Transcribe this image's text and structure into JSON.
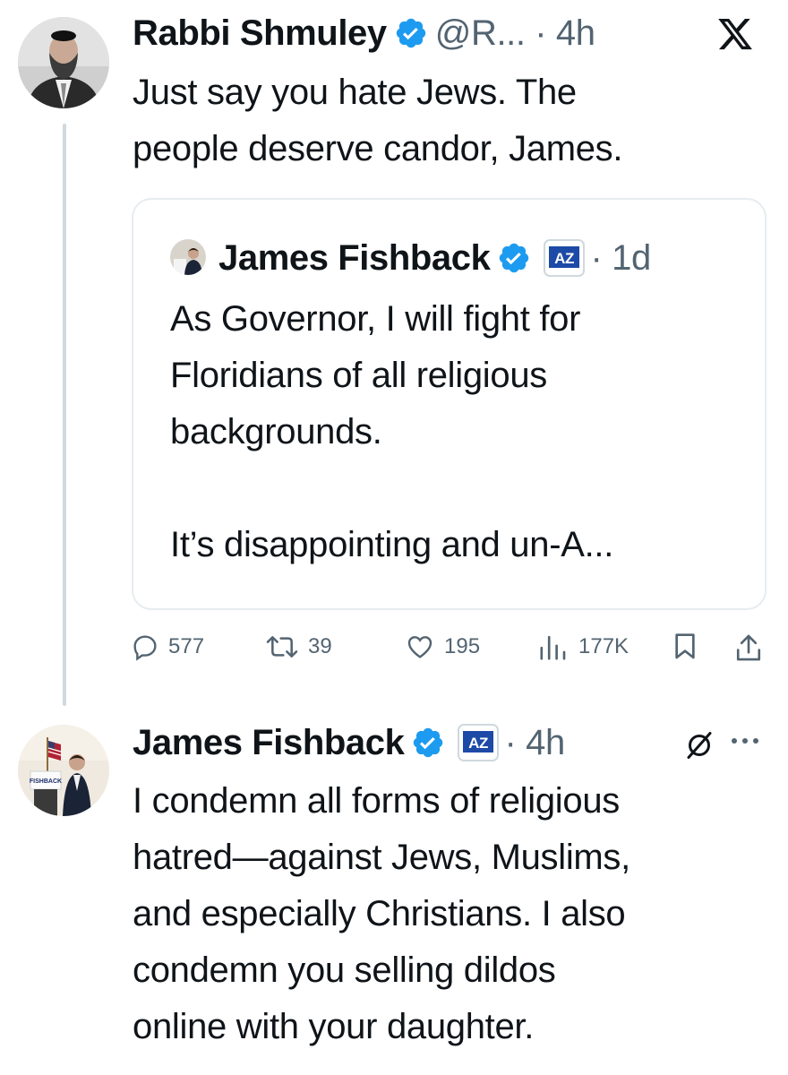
{
  "header_logo": "x-logo",
  "tweet1": {
    "author_name": "Rabbi Shmuley",
    "handle_time": "@R... · 4h",
    "text": "Just say you hate Jews. The\npeople deserve candor, James.",
    "quote": {
      "author_name": "James Fishback",
      "badge": "AZ",
      "time": "· 1d",
      "text": "As Governor, I will fight for\nFloridians of all religious\nbackgrounds.\n\nIt’s disappointing and un-A..."
    },
    "stats": {
      "replies": "577",
      "reposts": "39",
      "likes": "195",
      "views": "177K"
    }
  },
  "tweet2": {
    "author_name": "James Fishback",
    "badge": "AZ",
    "time": "· 4h",
    "text": "I condemn all forms of religious\nhatred—against Jews, Muslims,\nand especially Christians. I also\ncondemn you selling dildos\nonline with your daughter.",
    "avatar_sign": "FISHBACK"
  },
  "colors": {
    "verified": "#1d9bf0",
    "muted": "#536471",
    "border": "#e6ecf0",
    "az_badge": "#1c4aa6"
  }
}
